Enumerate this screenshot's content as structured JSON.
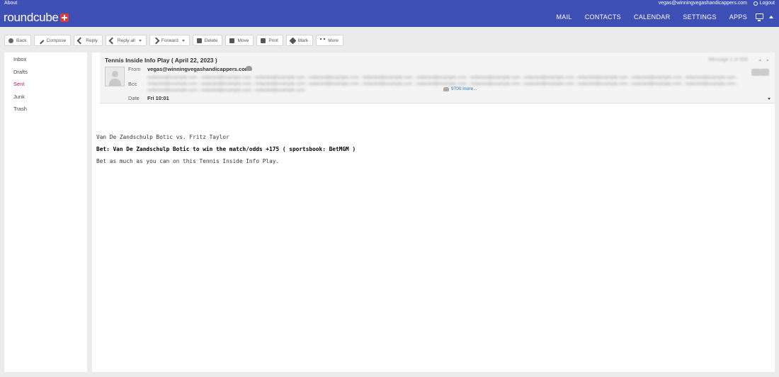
{
  "header": {
    "about": "About",
    "user_email": "vegas@winningvegashandicappers.com",
    "logout": "Logout",
    "logo": "roundcube",
    "nav": [
      "MAIL",
      "CONTACTS",
      "CALENDAR",
      "SETTINGS",
      "APPS"
    ],
    "accent_color": "#3e4fb5"
  },
  "toolbar": {
    "back": "Back",
    "compose": "Compose",
    "reply": "Reply",
    "reply_all": "Reply all",
    "forward": "Forward",
    "delete": "Delete",
    "move": "Move",
    "print": "Print",
    "mark": "Mark",
    "more": "More"
  },
  "sidebar": {
    "folders": [
      {
        "label": "Inbox"
      },
      {
        "label": "Drafts"
      },
      {
        "label": "Sent",
        "active": true
      },
      {
        "label": "Junk"
      },
      {
        "label": "Trash"
      }
    ]
  },
  "message": {
    "subject": "Tennis Inside Info Play ( April 22, 2023 )",
    "count": "Message 1 of 600",
    "from_label": "From",
    "from_value": "vegas@winningvegashandicappers.com",
    "bcc_label": "Bcc",
    "bcc_value": "redacted@example.com ; redacted@example.com ; redacted@example.com ; redacted@example.com ; redacted@example.com ; redacted@example.com ; redacted@example.com ; redacted@example.com ; redacted@example.com ; redacted@example.com ; redacted@example.com ; redacted@example.com ; redacted@example.com ; redacted@example.com ; redacted@example.com ; redacted@example.com ; redacted@example.com ; redacted@example.com ; redacted@example.com ; redacted@example.com ; redacted@example.com ; redacted@example.com ; redacted@example.com ; redacted@example.com ; redacted@example.com",
    "bcc_more": "9700 more...",
    "date_label": "Date",
    "date_value": "Fri 10:01",
    "body": {
      "line1": "Van De Zandschulp Botic vs. Fritz Taylor",
      "line2": "Bet: Van De Zandschulp Botic to win the match/odds +175 ( sportsbook: BetMGM )",
      "line3": "Bet as much as you can on this Tennis Inside Info Play."
    }
  }
}
